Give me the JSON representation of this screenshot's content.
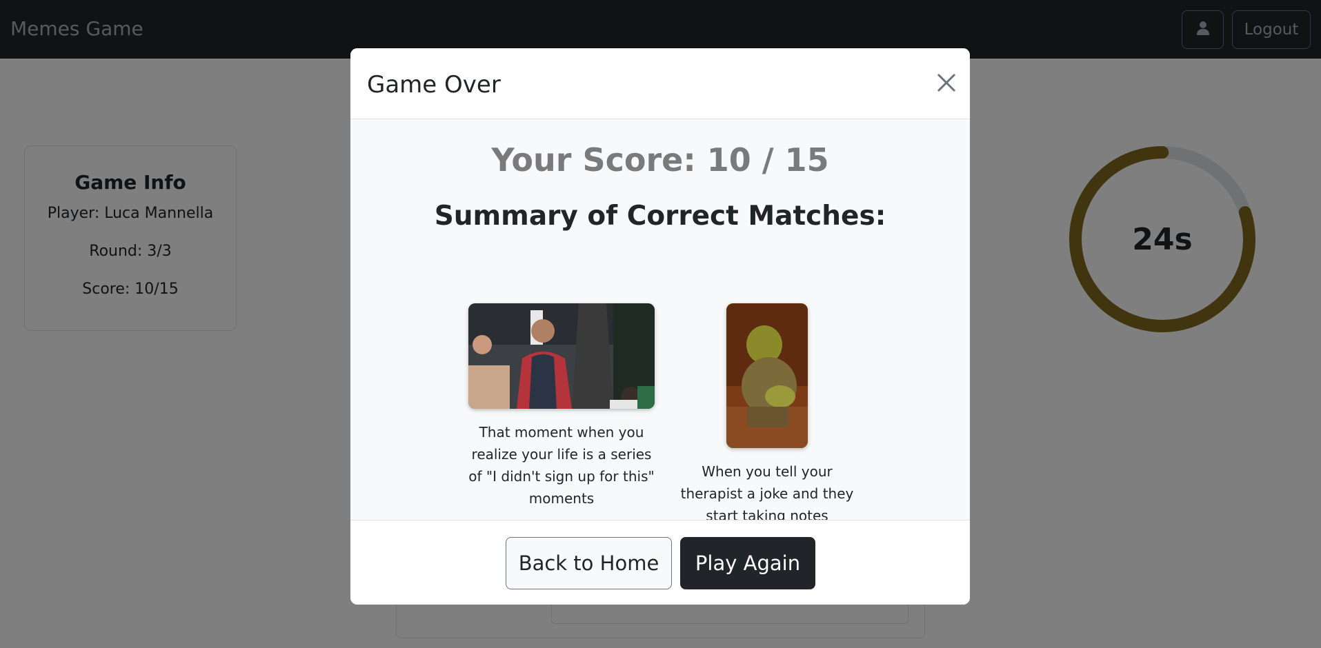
{
  "navbar": {
    "brand": "Memes Game",
    "logout_label": "Logout",
    "user_icon": "user-icon"
  },
  "game_info": {
    "title": "Game Info",
    "player": "Player: Luca Mannella",
    "round": "Round: 3/3",
    "score": "Score: 10/15"
  },
  "timer": {
    "label": "24s",
    "remaining_fraction": 0.8,
    "color": "#806a1c"
  },
  "modal": {
    "title": "Game Over",
    "close_icon": "close-icon",
    "score_text": "Your Score: 10 / 15",
    "summary_title": "Summary of Correct Matches:",
    "matches": [
      {
        "caption": "That moment when you realize your life is a series of \"I didn't sign up for this\" moments"
      },
      {
        "caption": "When you tell your therapist a joke and they start taking notes"
      }
    ],
    "back_home_label": "Back to Home",
    "play_again_label": "Play Again"
  }
}
